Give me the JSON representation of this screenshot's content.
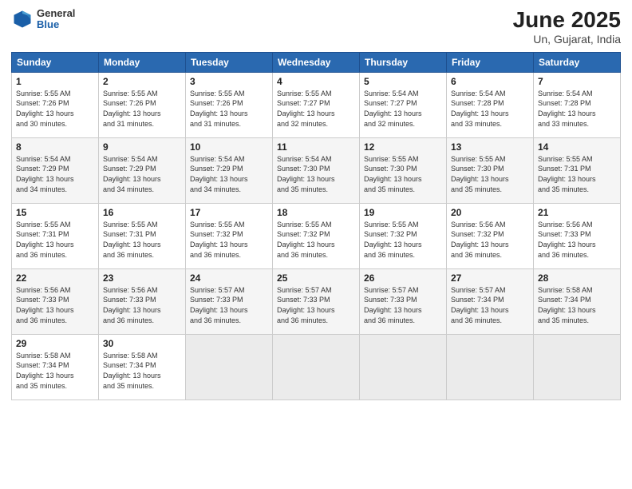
{
  "logo": {
    "general": "General",
    "blue": "Blue"
  },
  "title": "June 2025",
  "subtitle": "Un, Gujarat, India",
  "weekdays": [
    "Sunday",
    "Monday",
    "Tuesday",
    "Wednesday",
    "Thursday",
    "Friday",
    "Saturday"
  ],
  "weeks": [
    [
      {
        "day": "1",
        "info": "Sunrise: 5:55 AM\nSunset: 7:26 PM\nDaylight: 13 hours\nand 30 minutes."
      },
      {
        "day": "2",
        "info": "Sunrise: 5:55 AM\nSunset: 7:26 PM\nDaylight: 13 hours\nand 31 minutes."
      },
      {
        "day": "3",
        "info": "Sunrise: 5:55 AM\nSunset: 7:26 PM\nDaylight: 13 hours\nand 31 minutes."
      },
      {
        "day": "4",
        "info": "Sunrise: 5:55 AM\nSunset: 7:27 PM\nDaylight: 13 hours\nand 32 minutes."
      },
      {
        "day": "5",
        "info": "Sunrise: 5:54 AM\nSunset: 7:27 PM\nDaylight: 13 hours\nand 32 minutes."
      },
      {
        "day": "6",
        "info": "Sunrise: 5:54 AM\nSunset: 7:28 PM\nDaylight: 13 hours\nand 33 minutes."
      },
      {
        "day": "7",
        "info": "Sunrise: 5:54 AM\nSunset: 7:28 PM\nDaylight: 13 hours\nand 33 minutes."
      }
    ],
    [
      {
        "day": "8",
        "info": "Sunrise: 5:54 AM\nSunset: 7:29 PM\nDaylight: 13 hours\nand 34 minutes."
      },
      {
        "day": "9",
        "info": "Sunrise: 5:54 AM\nSunset: 7:29 PM\nDaylight: 13 hours\nand 34 minutes."
      },
      {
        "day": "10",
        "info": "Sunrise: 5:54 AM\nSunset: 7:29 PM\nDaylight: 13 hours\nand 34 minutes."
      },
      {
        "day": "11",
        "info": "Sunrise: 5:54 AM\nSunset: 7:30 PM\nDaylight: 13 hours\nand 35 minutes."
      },
      {
        "day": "12",
        "info": "Sunrise: 5:55 AM\nSunset: 7:30 PM\nDaylight: 13 hours\nand 35 minutes."
      },
      {
        "day": "13",
        "info": "Sunrise: 5:55 AM\nSunset: 7:30 PM\nDaylight: 13 hours\nand 35 minutes."
      },
      {
        "day": "14",
        "info": "Sunrise: 5:55 AM\nSunset: 7:31 PM\nDaylight: 13 hours\nand 35 minutes."
      }
    ],
    [
      {
        "day": "15",
        "info": "Sunrise: 5:55 AM\nSunset: 7:31 PM\nDaylight: 13 hours\nand 36 minutes."
      },
      {
        "day": "16",
        "info": "Sunrise: 5:55 AM\nSunset: 7:31 PM\nDaylight: 13 hours\nand 36 minutes."
      },
      {
        "day": "17",
        "info": "Sunrise: 5:55 AM\nSunset: 7:32 PM\nDaylight: 13 hours\nand 36 minutes."
      },
      {
        "day": "18",
        "info": "Sunrise: 5:55 AM\nSunset: 7:32 PM\nDaylight: 13 hours\nand 36 minutes."
      },
      {
        "day": "19",
        "info": "Sunrise: 5:55 AM\nSunset: 7:32 PM\nDaylight: 13 hours\nand 36 minutes."
      },
      {
        "day": "20",
        "info": "Sunrise: 5:56 AM\nSunset: 7:32 PM\nDaylight: 13 hours\nand 36 minutes."
      },
      {
        "day": "21",
        "info": "Sunrise: 5:56 AM\nSunset: 7:33 PM\nDaylight: 13 hours\nand 36 minutes."
      }
    ],
    [
      {
        "day": "22",
        "info": "Sunrise: 5:56 AM\nSunset: 7:33 PM\nDaylight: 13 hours\nand 36 minutes."
      },
      {
        "day": "23",
        "info": "Sunrise: 5:56 AM\nSunset: 7:33 PM\nDaylight: 13 hours\nand 36 minutes."
      },
      {
        "day": "24",
        "info": "Sunrise: 5:57 AM\nSunset: 7:33 PM\nDaylight: 13 hours\nand 36 minutes."
      },
      {
        "day": "25",
        "info": "Sunrise: 5:57 AM\nSunset: 7:33 PM\nDaylight: 13 hours\nand 36 minutes."
      },
      {
        "day": "26",
        "info": "Sunrise: 5:57 AM\nSunset: 7:33 PM\nDaylight: 13 hours\nand 36 minutes."
      },
      {
        "day": "27",
        "info": "Sunrise: 5:57 AM\nSunset: 7:34 PM\nDaylight: 13 hours\nand 36 minutes."
      },
      {
        "day": "28",
        "info": "Sunrise: 5:58 AM\nSunset: 7:34 PM\nDaylight: 13 hours\nand 35 minutes."
      }
    ],
    [
      {
        "day": "29",
        "info": "Sunrise: 5:58 AM\nSunset: 7:34 PM\nDaylight: 13 hours\nand 35 minutes."
      },
      {
        "day": "30",
        "info": "Sunrise: 5:58 AM\nSunset: 7:34 PM\nDaylight: 13 hours\nand 35 minutes."
      },
      {
        "day": "",
        "info": ""
      },
      {
        "day": "",
        "info": ""
      },
      {
        "day": "",
        "info": ""
      },
      {
        "day": "",
        "info": ""
      },
      {
        "day": "",
        "info": ""
      }
    ]
  ]
}
